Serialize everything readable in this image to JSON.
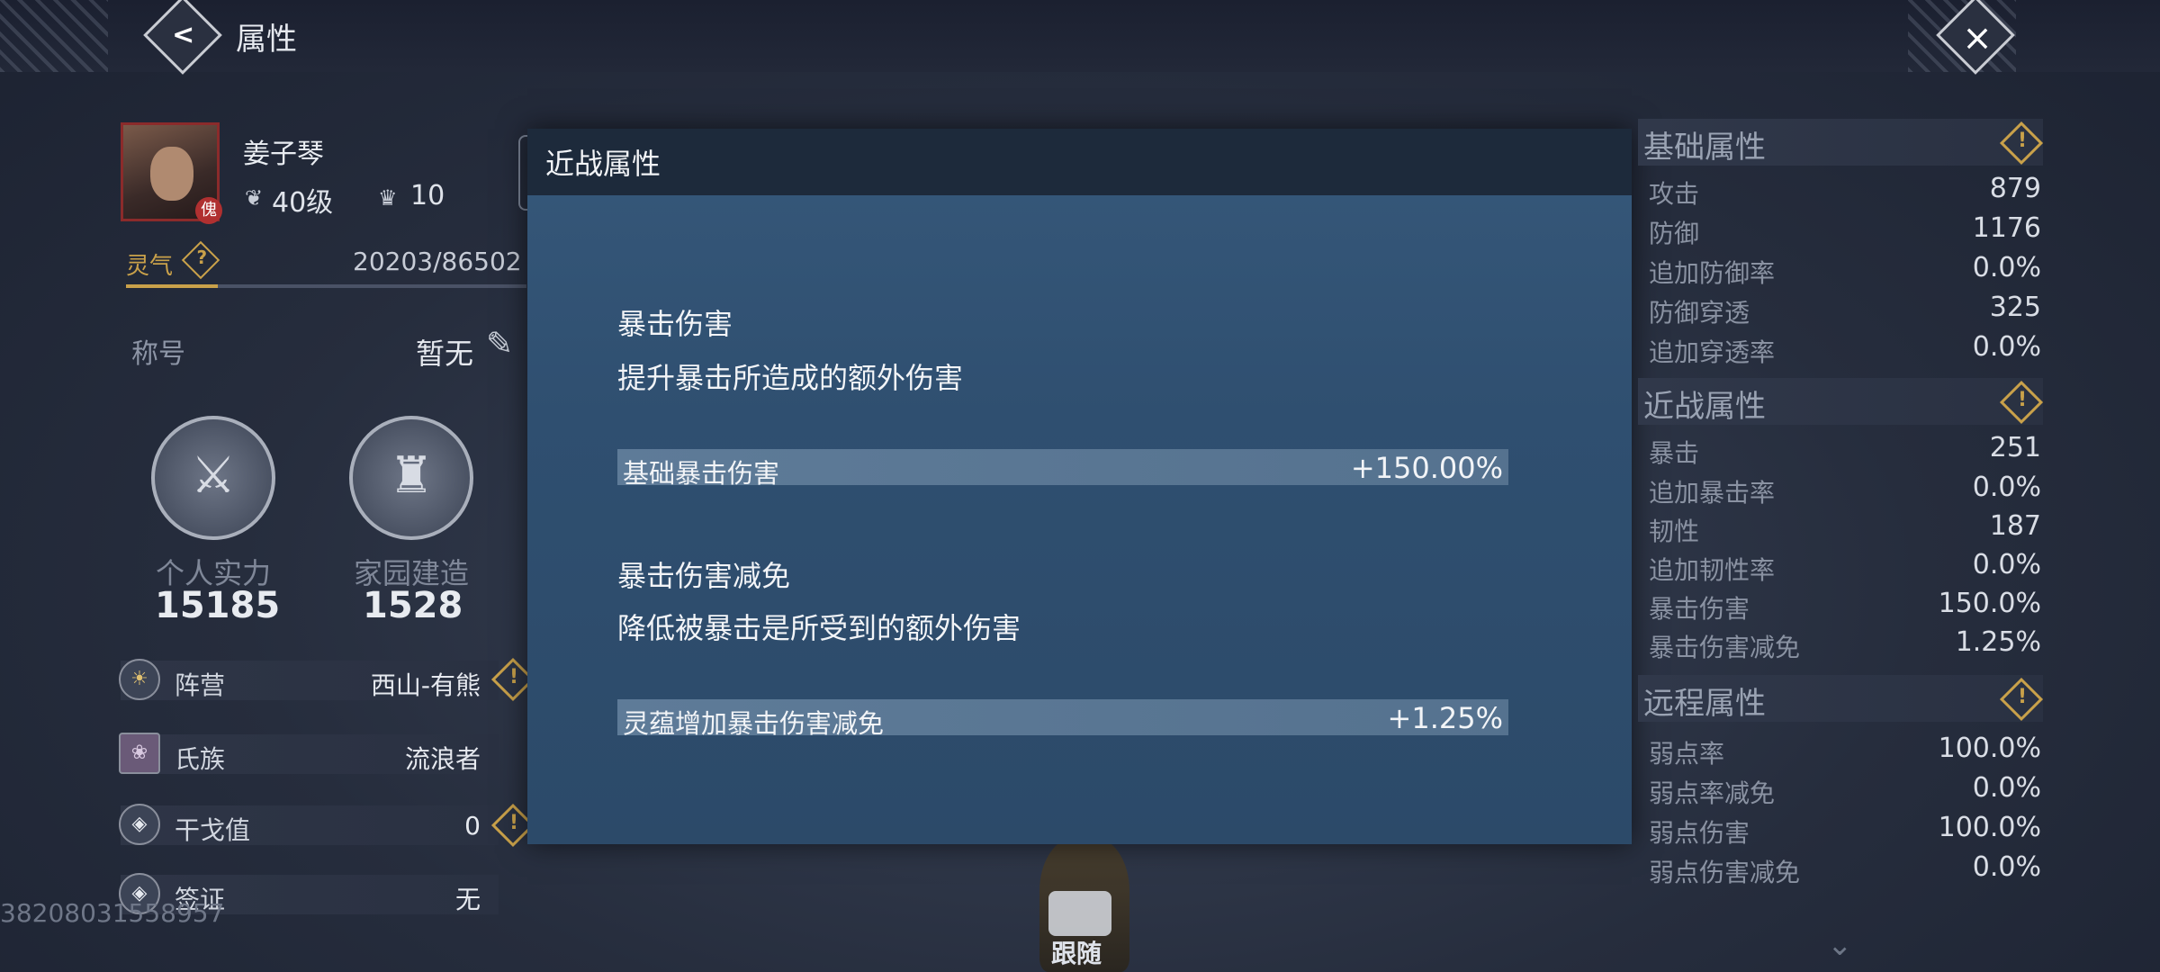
{
  "header": {
    "title": "属性"
  },
  "player": {
    "name": "姜子琴",
    "level": "40级",
    "rank": "10",
    "badge": "傀"
  },
  "lingqi": {
    "label": "灵气",
    "value": "20203/86502"
  },
  "title_row": {
    "label": "称号",
    "value": "暂无"
  },
  "emblems": [
    {
      "label": "个人实力",
      "value": "15185"
    },
    {
      "label": "家园建造",
      "value": "1528"
    }
  ],
  "info_rows": [
    {
      "label": "阵营",
      "value": "西山-有熊"
    },
    {
      "label": "氏族",
      "value": "流浪者"
    },
    {
      "label": "干戈值",
      "value": "0"
    },
    {
      "label": "签证",
      "value": "无"
    }
  ],
  "player_id": "38208031558957",
  "popup": {
    "title": "近战属性",
    "sections": [
      {
        "title": "暴击伤害",
        "desc": "提升暴击所造成的额外伤害",
        "stat_label": "基础暴击伤害",
        "stat_value": "+150.00%"
      },
      {
        "title": "暴击伤害减免",
        "desc": "降低被暴击是所受到的额外伤害",
        "stat_label": "灵蕴增加暴击伤害减免",
        "stat_value": "+1.25%"
      }
    ]
  },
  "follow": {
    "label": "跟随"
  },
  "attributes": {
    "basic": {
      "title": "基础属性",
      "rows": [
        {
          "label": "攻击",
          "value": "879"
        },
        {
          "label": "防御",
          "value": "1176"
        },
        {
          "label": "追加防御率",
          "value": "0.0%"
        },
        {
          "label": "防御穿透",
          "value": "325"
        },
        {
          "label": "追加穿透率",
          "value": "0.0%"
        }
      ]
    },
    "melee": {
      "title": "近战属性",
      "rows": [
        {
          "label": "暴击",
          "value": "251"
        },
        {
          "label": "追加暴击率",
          "value": "0.0%"
        },
        {
          "label": "韧性",
          "value": "187"
        },
        {
          "label": "追加韧性率",
          "value": "0.0%"
        },
        {
          "label": "暴击伤害",
          "value": "150.0%"
        },
        {
          "label": "暴击伤害减免",
          "value": "1.25%"
        }
      ]
    },
    "ranged": {
      "title": "远程属性",
      "rows": [
        {
          "label": "弱点率",
          "value": "100.0%"
        },
        {
          "label": "弱点率减免",
          "value": "0.0%"
        },
        {
          "label": "弱点伤害",
          "value": "100.0%"
        },
        {
          "label": "弱点伤害减免",
          "value": "0.0%"
        }
      ]
    }
  }
}
